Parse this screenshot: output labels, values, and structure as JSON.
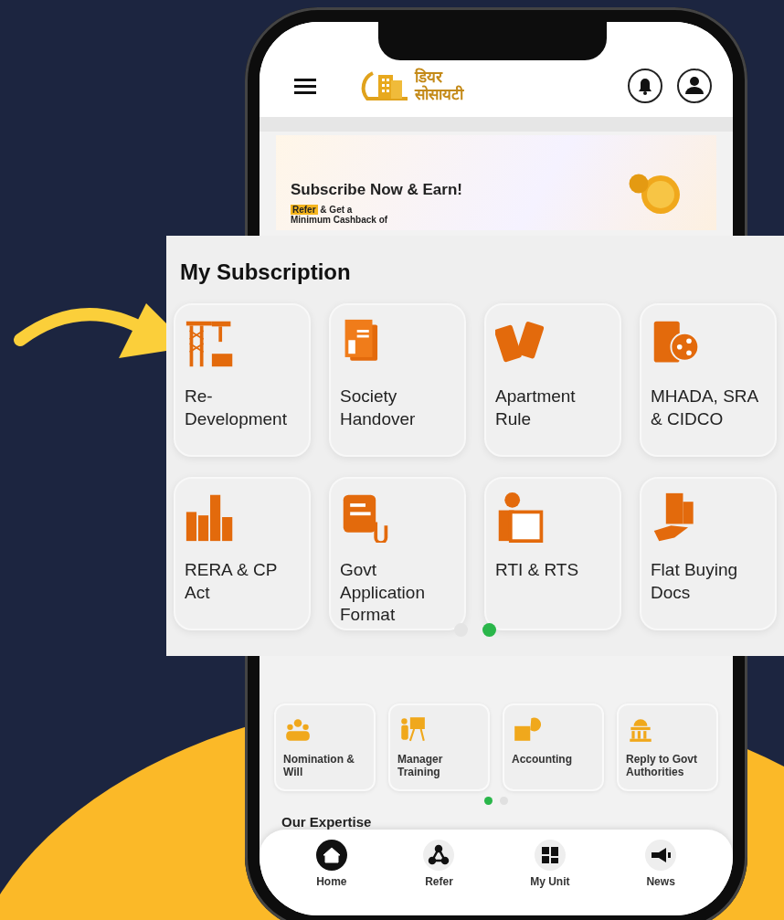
{
  "app_header": {
    "logo_text": [
      "डियर",
      "सोसायटी"
    ]
  },
  "banner": {
    "title": "Subscribe Now & Earn!",
    "highlight": "Refer",
    "line_1": "& Get a",
    "line_2": "Minimum Cashback of"
  },
  "services": {
    "items": [
      {
        "label": "Nomination & Will"
      },
      {
        "label": "Manager Training"
      },
      {
        "label": "Accounting"
      },
      {
        "label": "Reply to Govt Authorities"
      }
    ],
    "pages": [
      {
        "selected": true
      },
      {
        "selected": false
      }
    ]
  },
  "section_heading": "Our Expertise",
  "bottom_nav": [
    {
      "label": "Home",
      "selected": true
    },
    {
      "label": "Refer",
      "selected": false
    },
    {
      "label": "My Unit",
      "selected": false
    },
    {
      "label": "News",
      "selected": false
    }
  ],
  "subscription_panel": {
    "title": "My Subscription",
    "items": [
      {
        "label": "Re-\nDevelopment"
      },
      {
        "label": "Society\nHandover"
      },
      {
        "label": "Apartment\nRule"
      },
      {
        "label": "MHADA, SRA\n& CIDCO"
      },
      {
        "label": "RERA & CP\nAct"
      },
      {
        "label": "Govt\nApplication\nFormat"
      },
      {
        "label": "RTI & RTS"
      },
      {
        "label": "Flat Buying\nDocs"
      }
    ],
    "pages": [
      {
        "selected": false
      },
      {
        "selected": true
      }
    ]
  }
}
